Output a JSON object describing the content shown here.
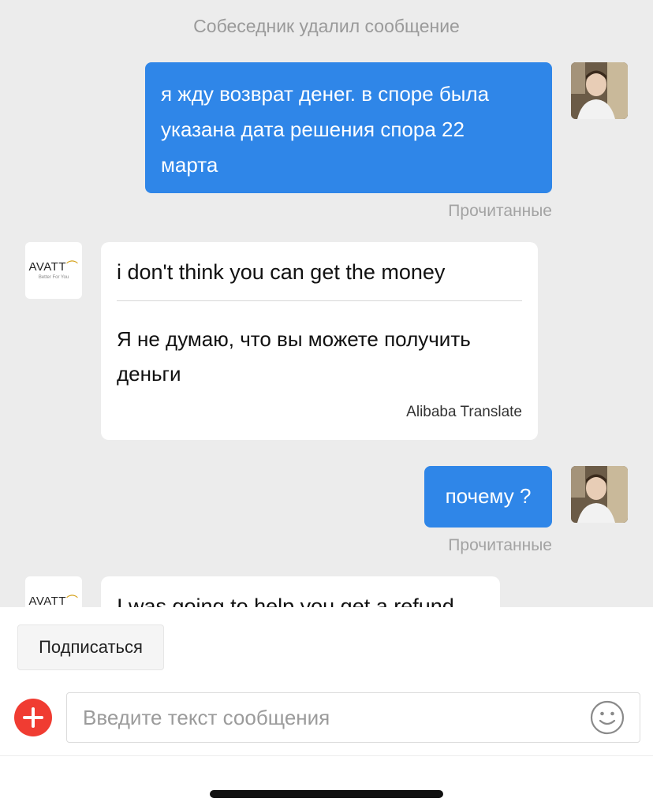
{
  "chat": {
    "system_note": "Собеседник удалил сообщение",
    "messages": [
      {
        "sender": "user",
        "text_lines": [
          "я жду возврат денег. в споре была",
          "указана дата решения спора 22",
          "марта"
        ],
        "status": "Прочитанные"
      },
      {
        "sender": "shop",
        "original": "i don't think you can get the money",
        "translation_lines": [
          "Я не думаю, что вы можете получить",
          "деньги"
        ],
        "translator": "Alibaba Translate"
      },
      {
        "sender": "user",
        "text": "почему ?",
        "status": "Прочитанные"
      },
      {
        "sender": "shop",
        "original": "I was going to help you get a refund"
      }
    ]
  },
  "shop_avatar": {
    "name": "AVATT",
    "tagline": "Better For You"
  },
  "bottom": {
    "subscribe_label": "Подписаться",
    "input_placeholder": "Введите текст сообщения"
  },
  "icons": {
    "attach": "plus-circle-icon",
    "emoji": "smiley-icon",
    "accent": "#2f86e8",
    "plus_color": "#f03c32"
  }
}
